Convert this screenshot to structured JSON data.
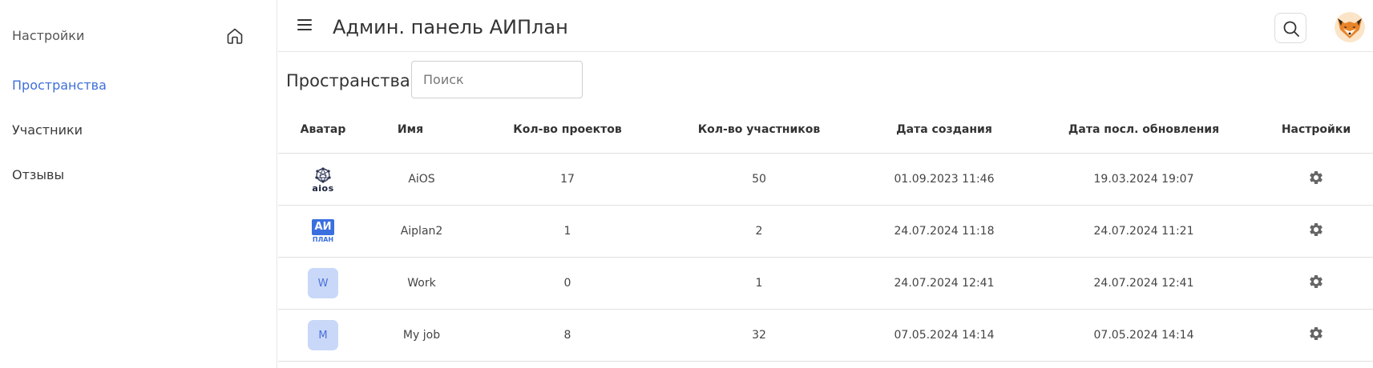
{
  "sidebar": {
    "settings_label": "Настройки",
    "items": [
      {
        "label": "Пространства",
        "active": true
      },
      {
        "label": "Участники",
        "active": false
      },
      {
        "label": "Отзывы",
        "active": false
      }
    ]
  },
  "header": {
    "title": "Админ. панель АИПлан"
  },
  "page": {
    "heading": "Пространства",
    "search_placeholder": "Поиск",
    "search_value": ""
  },
  "table": {
    "columns": [
      "Аватар",
      "Имя",
      "Кол-во проектов",
      "Кол-во участников",
      "Дата создания",
      "Дата посл. обновления",
      "Настройки"
    ],
    "rows": [
      {
        "avatar": "aios-logo",
        "avatar_text": "aios",
        "name": "AiOS",
        "projects": "17",
        "members": "50",
        "created": "01.09.2023 11:46",
        "updated": "19.03.2024 19:07"
      },
      {
        "avatar": "aiplan-logo",
        "avatar_text": "АИ",
        "avatar_sub": "ПЛАН",
        "name": "Aiplan2",
        "projects": "1",
        "members": "2",
        "created": "24.07.2024 11:18",
        "updated": "24.07.2024 11:21"
      },
      {
        "avatar": "letter",
        "avatar_text": "W",
        "name": "Work",
        "projects": "0",
        "members": "1",
        "created": "24.07.2024 12:41",
        "updated": "24.07.2024 12:41"
      },
      {
        "avatar": "letter",
        "avatar_text": "M",
        "name": "My job",
        "projects": "8",
        "members": "32",
        "created": "07.05.2024 14:14",
        "updated": "07.05.2024 14:14"
      }
    ]
  },
  "icons": {
    "home": "home-icon",
    "menu": "hamburger-menu-icon",
    "search": "search-icon",
    "gear": "gear-icon",
    "user_avatar": "fox-avatar"
  },
  "colors": {
    "accent": "#3f6fd9",
    "letter_avatar_bg": "#c9d8f8",
    "aiplan_blue": "#3a6fe0",
    "gear": "#666666"
  }
}
